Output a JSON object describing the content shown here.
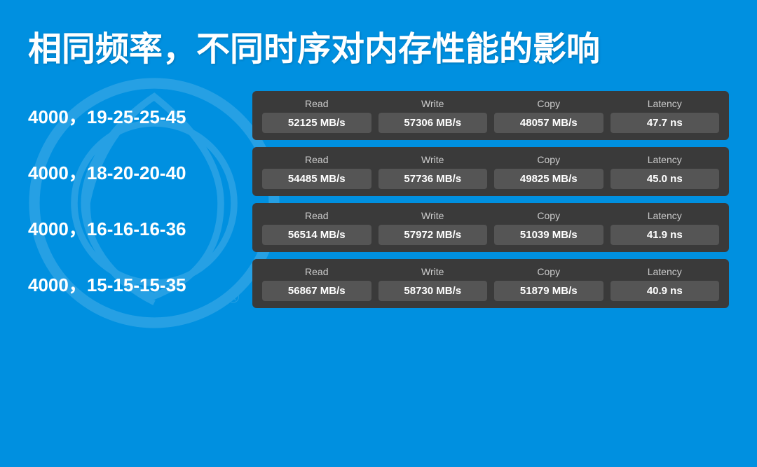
{
  "title": "相同频率，不同时序对内存性能的影响",
  "rows": [
    {
      "label": "4000，19-25-25-45",
      "read": "52125 MB/s",
      "write": "57306 MB/s",
      "copy": "48057 MB/s",
      "latency": "47.7 ns"
    },
    {
      "label": "4000，18-20-20-40",
      "read": "54485 MB/s",
      "write": "57736 MB/s",
      "copy": "49825 MB/s",
      "latency": "45.0 ns"
    },
    {
      "label": "4000，16-16-16-36",
      "read": "56514 MB/s",
      "write": "57972 MB/s",
      "copy": "51039 MB/s",
      "latency": "41.9 ns"
    },
    {
      "label": "4000，15-15-15-35",
      "read": "56867 MB/s",
      "write": "58730 MB/s",
      "copy": "51879 MB/s",
      "latency": "40.9 ns"
    }
  ],
  "headers": {
    "read": "Read",
    "write": "Write",
    "copy": "Copy",
    "latency": "Latency"
  }
}
